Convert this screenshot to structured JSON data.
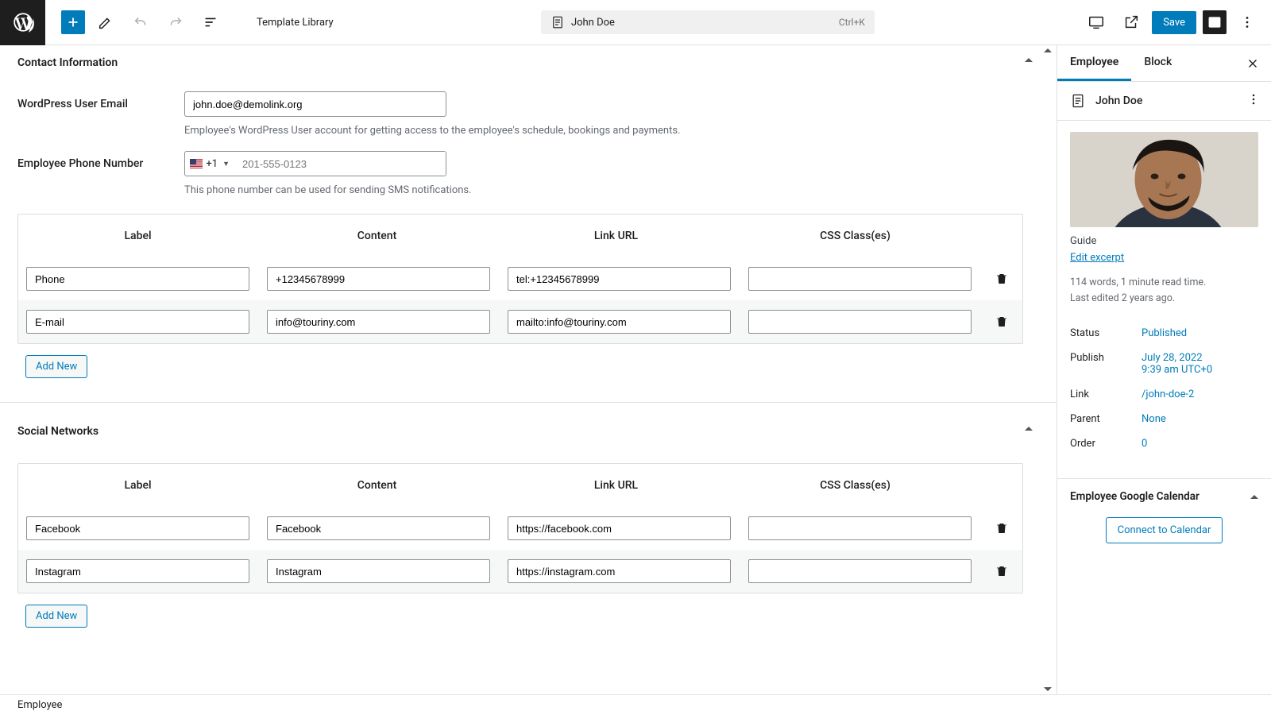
{
  "topbar": {
    "template_library": "Template Library",
    "doc_title": "John Doe",
    "shortcut": "Ctrl+K",
    "save": "Save"
  },
  "sections": {
    "contact": {
      "title": "Contact Information",
      "email_label": "WordPress User Email",
      "email_value": "john.doe@demolink.org",
      "email_help": "Employee's WordPress User account for getting access to the employee's schedule, bookings and payments.",
      "phone_label": "Employee Phone Number",
      "phone_code": "+1",
      "phone_placeholder": "201-555-0123",
      "phone_help": "This phone number can be used for sending SMS notifications.",
      "table_headers": {
        "label": "Label",
        "content": "Content",
        "link": "Link URL",
        "css": "CSS Class(es)"
      },
      "rows": [
        {
          "label": "Phone",
          "content": "+12345678999",
          "link": "tel:+12345678999",
          "css": ""
        },
        {
          "label": "E-mail",
          "content": "info@touriny.com",
          "link": "mailto:info@touriny.com",
          "css": ""
        }
      ],
      "add_new": "Add New"
    },
    "social": {
      "title": "Social Networks",
      "table_headers": {
        "label": "Label",
        "content": "Content",
        "link": "Link URL",
        "css": "CSS Class(es)"
      },
      "rows": [
        {
          "label": "Facebook",
          "content": "Facebook",
          "link": "https://facebook.com",
          "css": ""
        },
        {
          "label": "Instagram",
          "content": "Instagram",
          "link": "https://instagram.com",
          "css": ""
        }
      ],
      "add_new": "Add New"
    }
  },
  "sidebar": {
    "tab_employee": "Employee",
    "tab_block": "Block",
    "name": "John Doe",
    "role": "Guide",
    "edit_excerpt": "Edit excerpt",
    "meta_words": "114 words, 1 minute read time.",
    "meta_edited": "Last edited 2 years ago.",
    "props": {
      "status_k": "Status",
      "status_v": "Published",
      "publish_k": "Publish",
      "publish_v1": "July 28, 2022",
      "publish_v2": "9:39 am UTC+0",
      "link_k": "Link",
      "link_v": "/john-doe-2",
      "parent_k": "Parent",
      "parent_v": "None",
      "order_k": "Order",
      "order_v": "0"
    },
    "calendar_title": "Employee Google Calendar",
    "connect": "Connect to Calendar"
  },
  "footer": {
    "breadcrumb": "Employee"
  }
}
